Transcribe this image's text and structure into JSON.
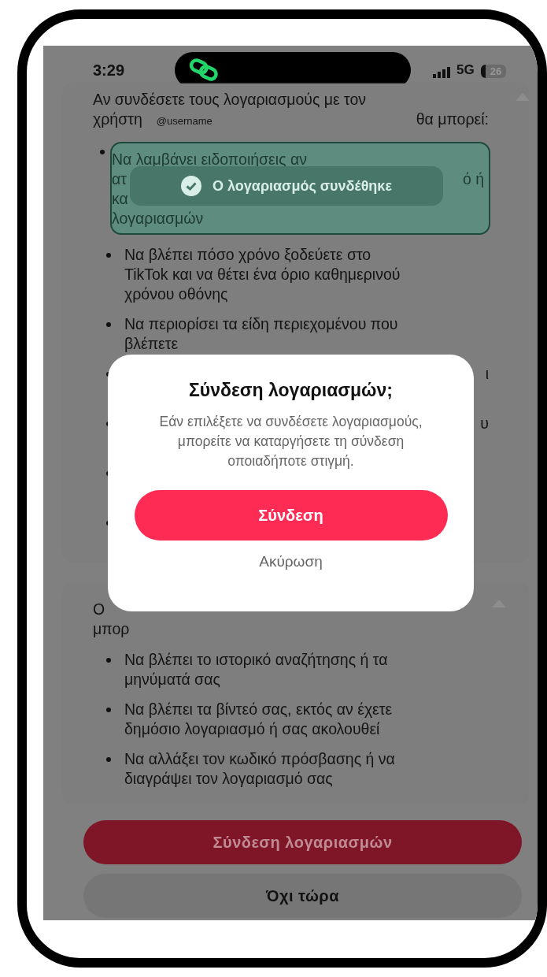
{
  "status_bar": {
    "time": "3:29",
    "network": "5G",
    "battery": "26"
  },
  "intro": {
    "line_1": "Αν συνδέσετε τους λογαριασμούς με τον",
    "prefix": "χρήστη",
    "username": "@username",
    "suffix": "θα μπορεί:"
  },
  "can_do": [
    {
      "kind": "highlighted",
      "lines": [
        {
          "left": "Να λαμβάνει ειδοποιήσεις αν"
        },
        {
          "left": "ατ",
          "right": "ό ή"
        },
        {
          "left": "κα"
        },
        {
          "left": "λογαριασμών"
        }
      ]
    },
    {
      "kind": "plain",
      "lines": [
        {
          "left": "Να βλέπει πόσο χρόνο ξοδεύετε στο"
        },
        {
          "left": "TikTok και να θέτει ένα όριο καθημερινού"
        },
        {
          "left": "χρόνου οθόνης"
        }
      ]
    },
    {
      "kind": "plain",
      "lines": [
        {
          "left": "Να περιορίσει τα είδη περιεχομένου που"
        },
        {
          "left": "βλέπετε"
        }
      ]
    },
    {
      "kind": "covered",
      "lines": [
        {
          "right": "ι"
        }
      ]
    },
    {
      "kind": "covered",
      "lines": [
        {
          "right": "υ"
        }
      ]
    },
    {
      "kind": "covered"
    },
    {
      "kind": "covered"
    }
  ],
  "cannot_header": [
    {
      "left": "Ο"
    },
    {
      "left": "μπορ"
    }
  ],
  "cannot_do": [
    {
      "kind": "plain",
      "lines": [
        {
          "left": "Να βλέπει το ιστορικό αναζήτησης ή τα"
        },
        {
          "left": "μηνύματά σας"
        }
      ]
    },
    {
      "kind": "plain",
      "lines": [
        {
          "left": "Να βλέπει τα βίντεό σας, εκτός αν έχετε"
        },
        {
          "left": "δημόσιο λογαριασμό ή σας ακολουθεί"
        }
      ]
    },
    {
      "kind": "plain",
      "lines": [
        {
          "left": "Να αλλάξει τον κωδικό πρόσβασης ή να"
        },
        {
          "left": "διαγράψει τον λογαριασμό σας"
        }
      ]
    }
  ],
  "buttons": [
    {
      "label": "Σύνδεση λογαριασμών",
      "kind": "primary"
    },
    {
      "label": "Όχι τώρα",
      "kind": "secondary"
    }
  ],
  "toast": {
    "message": "Ο λογαριασμός συνδέθηκε"
  },
  "dialog": {
    "title": "Σύνδεση λογαριασμών;",
    "body": "Εάν επιλέξετε να συνδέσετε λογαριασμούς, μπορείτε να καταργήσετε τη σύνδεση οποιαδήποτε στιγμή.",
    "confirm": "Σύνδεση",
    "cancel": "Ακύρωση"
  }
}
